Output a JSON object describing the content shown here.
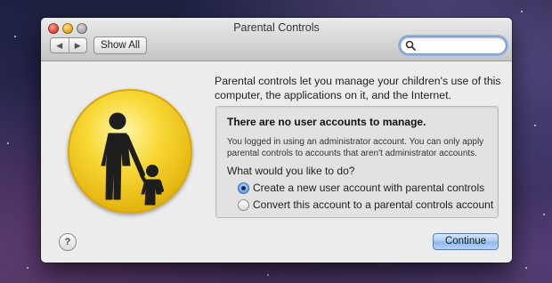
{
  "window": {
    "title": "Parental Controls",
    "toolbar": {
      "back_icon": "triangle-left",
      "forward_icon": "triangle-right",
      "show_all_label": "Show All",
      "search_icon": "magnifier",
      "search_value": ""
    }
  },
  "content": {
    "intro": "Parental controls let you manage your children's use of this computer, the applications on it, and the Internet.",
    "panel": {
      "heading": "There are no user accounts to manage.",
      "message": "You logged in using an administrator account. You can only apply parental controls to accounts that aren't administrator accounts.",
      "question": "What would you like to do?",
      "options": [
        {
          "label": "Create a new user account with parental controls",
          "selected": true
        },
        {
          "label": "Convert this account to a parental controls account",
          "selected": false
        }
      ]
    },
    "help_label": "?",
    "continue_label": "Continue"
  },
  "colors": {
    "badge_yellow": "#f8d836",
    "figure_dark": "#1e1e1e",
    "accent_blue": "#3b6cc5"
  }
}
